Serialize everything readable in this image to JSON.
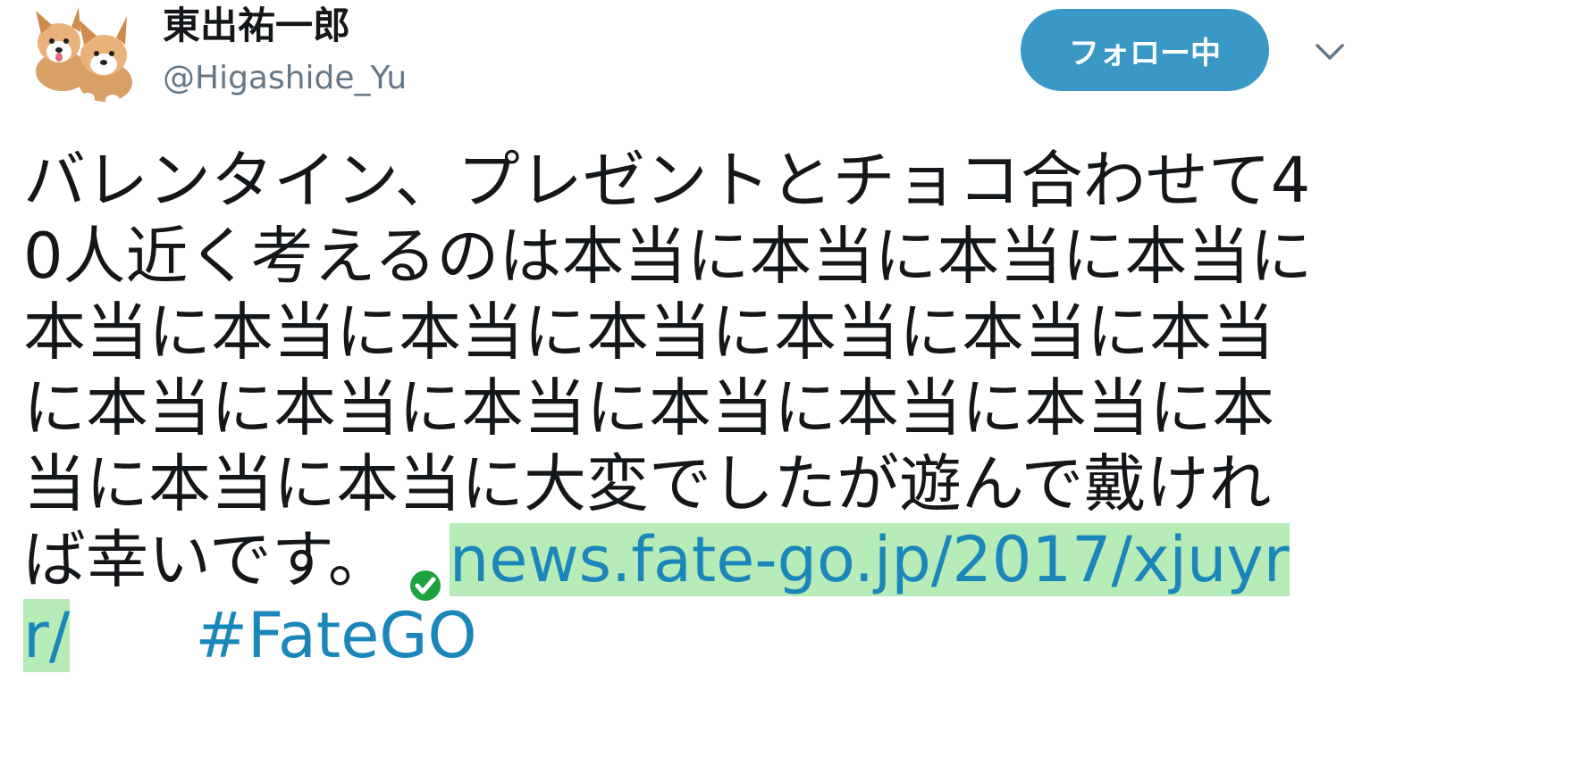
{
  "user": {
    "display_name": "東出祐一郎",
    "handle": "@Higashide_Yu",
    "avatar_icon": "corgi-avatar-icon"
  },
  "actions": {
    "follow_label": "フォロー中",
    "more_icon": "chevron-down-icon"
  },
  "tweet": {
    "body": "バレンタイン、プレゼントとチョコ合わせて40人近く考えるのは本当に本当に本当に本当に本当に本当に本当に本当に本当に本当に本当に本当に本当に本当に本当に本当に本当に本当に本当に本当に大変でしたが遊んで戴ければ幸いです。",
    "link_icon": "verified-check-icon",
    "link_text": "news.fate-go.jp/2017/xjuyrr/",
    "hashtag": "#FateGO"
  },
  "colors": {
    "follow_button": "#3a98c6",
    "link": "#1b86b9",
    "link_highlight": "#b7ebb8",
    "verified": "#1da33e"
  }
}
